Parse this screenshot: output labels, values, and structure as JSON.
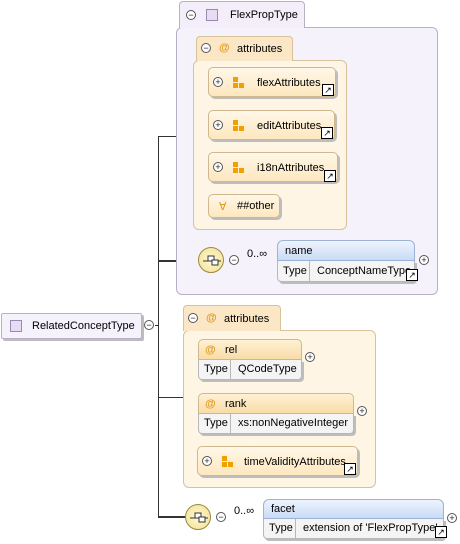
{
  "root": {
    "label": "RelatedConceptType",
    "collapse": "−"
  },
  "flex": {
    "title": "FlexPropType",
    "attributes_label": "attributes",
    "groups": [
      {
        "label": "flexAttributes"
      },
      {
        "label": "editAttributes"
      },
      {
        "label": "i18nAttributes"
      }
    ],
    "other": "##other",
    "name_element": {
      "name": "name",
      "type_label": "Type",
      "type_value": "ConceptNameType",
      "cardinality": "0..∞"
    }
  },
  "rel_attrs": {
    "attributes_label": "attributes",
    "rel": {
      "name": "rel",
      "type_label": "Type",
      "type_value": "QCodeType"
    },
    "rank": {
      "name": "rank",
      "type_label": "Type",
      "type_value": "xs:nonNegativeInteger"
    },
    "group": {
      "label": "timeValidityAttributes"
    }
  },
  "facet": {
    "name": "facet",
    "type_label": "Type",
    "type_value": "extension of 'FlexPropType'",
    "cardinality": "0..∞"
  },
  "glyphs": {
    "at": "@",
    "plus": "+",
    "minus": "−",
    "any": "∀",
    "link": "↗"
  }
}
